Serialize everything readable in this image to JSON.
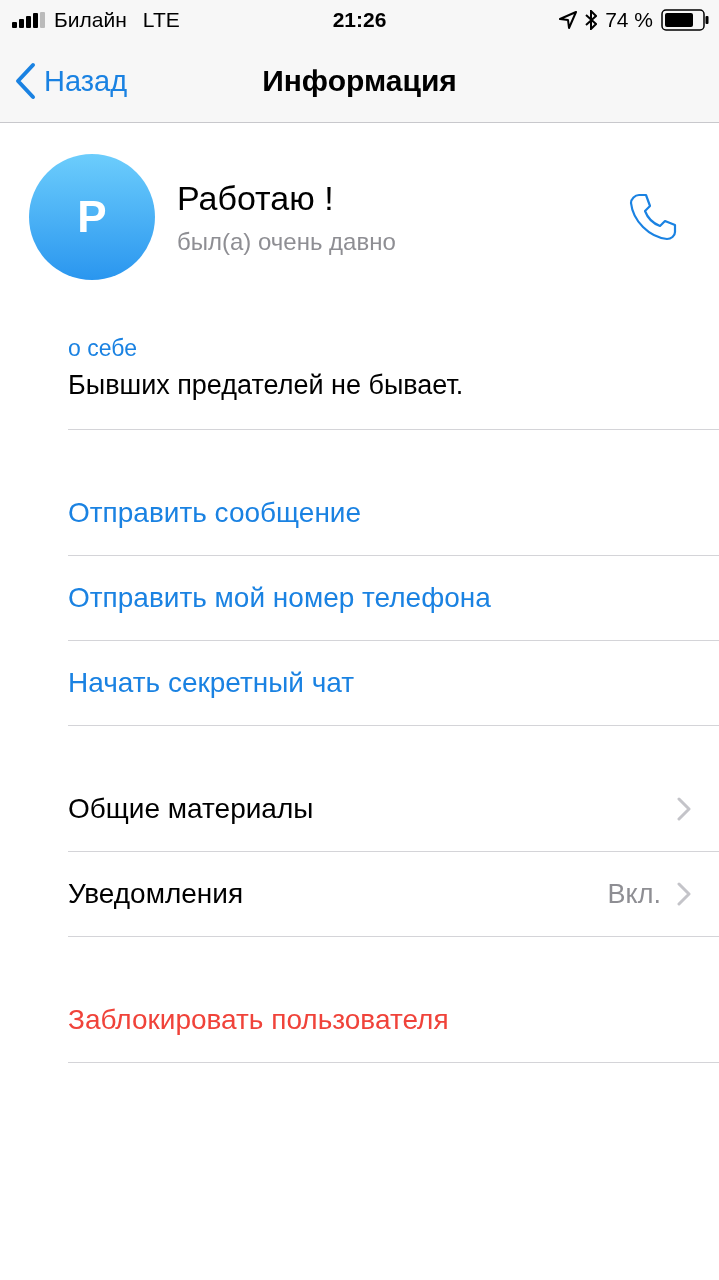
{
  "status_bar": {
    "carrier": "Билайн",
    "network": "LTE",
    "time": "21:26",
    "battery": "74 %"
  },
  "nav": {
    "back": "Назад",
    "title": "Информация"
  },
  "profile": {
    "initial": "P",
    "name": "Работаю !",
    "last_seen": "был(а) очень давно"
  },
  "about": {
    "label": "о себе",
    "text": "Бывших предателей не бывает."
  },
  "sections": [
    [
      {
        "label": "Отправить сообщение",
        "kind": "action"
      },
      {
        "label": "Отправить мой номер телефона",
        "kind": "action"
      },
      {
        "label": "Начать секретный чат",
        "kind": "action"
      }
    ],
    [
      {
        "label": "Общие материалы",
        "kind": "nav"
      },
      {
        "label": "Уведомления",
        "kind": "nav",
        "value": "Вкл."
      }
    ],
    [
      {
        "label": "Заблокировать пользователя",
        "kind": "danger"
      }
    ]
  ]
}
